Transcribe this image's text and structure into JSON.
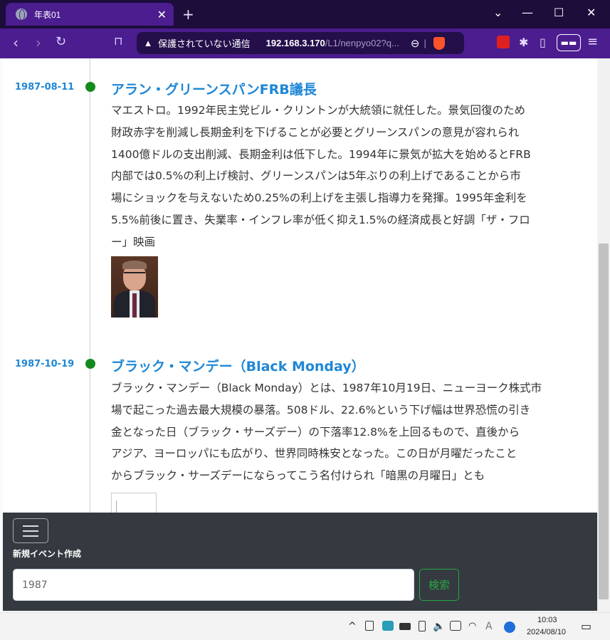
{
  "tab": {
    "title": "年表01",
    "close": "✕"
  },
  "window": {
    "new_tab": "+",
    "chevron": "⌄",
    "minimize": "—",
    "maximize": "☐",
    "close": "✕"
  },
  "toolbar": {
    "back": "‹",
    "forward": "›",
    "reload": "↻",
    "bookmark": "⊓",
    "insecure_label": "保護されていない通信",
    "url_host": "192.168.3.170",
    "url_path": "/L1/nenpyo02?q...",
    "zoom": "⊖",
    "divider": "|",
    "menu": "≡",
    "extensions": "✱",
    "sidebar": "▯",
    "glasses": "👓"
  },
  "events": [
    {
      "date": "1987-08-11",
      "title": "アラン・グリーンスパンFRB議長",
      "lines": [
        "マエストロ。1992年民主党ビル・クリントンが大統領に就任した。景気回復のため",
        "財政赤字を削減し長期金利を下げることが必要とグリーンスパンの意見が容れられ",
        "1400億ドルの支出削減、長期金利は低下した。1994年に景気が拡大を始めるとFRB",
        "内部では0.5%の利上げ検討、グリーンスパンは5年ぶりの利上げであることから市",
        "場にショックを与えないため0.25%の利上げを主張し指導力を発揮。1995年金利を",
        "5.5%前後に置き、失業率・インフレ率が低く抑え1.5%の経済成長と好調「ザ・フロ",
        "ー」映画"
      ]
    },
    {
      "date": "1987-10-19",
      "title": "ブラック・マンデー（Black Monday）",
      "lines": [
        "ブラック・マンデー（Black Monday）とは、1987年10月19日、ニューヨーク株式市",
        "場で起こった過去最大規模の暴落。508ドル、22.6%という下げ幅は世界恐慌の引き",
        "金となった日（ブラック・サーズデー）の下落率12.8%を上回るもので、直後から",
        "アジア、ヨーロッパにも広がり、世界同時株安となった。この日が月曜だったこと",
        "からブラック・サーズデーにならってこう名付けられ「暗黒の月曜日」とも"
      ]
    }
  ],
  "panel": {
    "new_event_label": "新規イベント作成",
    "search_value": "1987",
    "search_button": "検索"
  },
  "taskbar": {
    "time": "10:03",
    "date": "2024/08/10",
    "ime": "A",
    "chevron": "^",
    "notification": "▭"
  }
}
